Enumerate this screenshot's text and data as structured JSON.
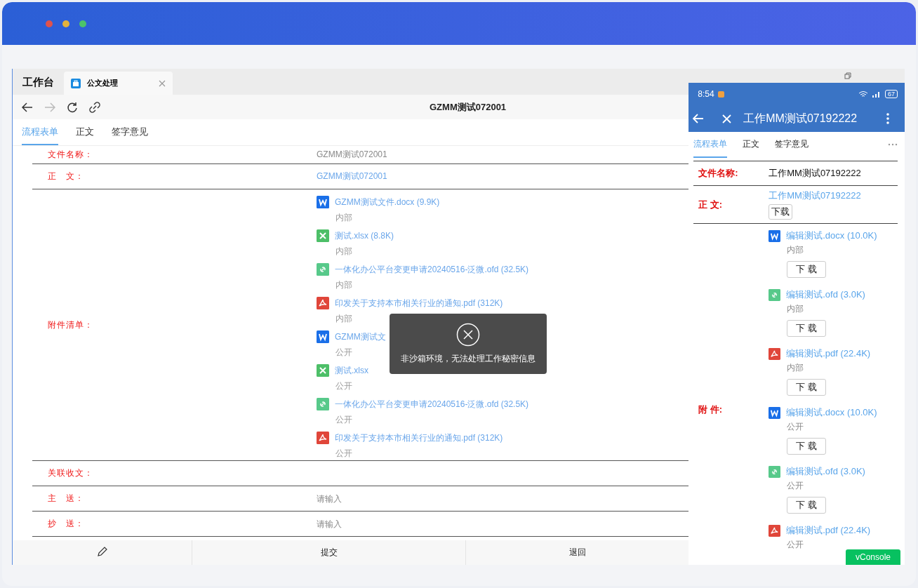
{
  "desktop": {
    "home_tab": "工作台",
    "tabs": [
      {
        "label": "公文处理",
        "selected": true
      }
    ],
    "page_title": "GZMM测试072001",
    "form_tabs": [
      {
        "label": "流程表单",
        "selected": true
      },
      {
        "label": "正文",
        "selected": false
      },
      {
        "label": "签字意见",
        "selected": false
      }
    ],
    "form": {
      "name_label": "文件名称：",
      "name_value": "GZMM测试072001",
      "body_label": "正　文：",
      "body_link": "GZMM测试072001",
      "attachments_label": "附件清单：",
      "attachments": [
        {
          "kind": "word",
          "name": "GZMM测试文件.docx (9.9K)",
          "access": "内部"
        },
        {
          "kind": "excel",
          "name": "测试.xlsx (8.8K)",
          "access": "内部"
        },
        {
          "kind": "ofd",
          "name": "一体化办公平台变更申请20240516-泛微.ofd (32.5K)",
          "access": "内部"
        },
        {
          "kind": "pdf",
          "name": "印发关于支持本市相关行业的通知.pdf (312K)",
          "access": "内部"
        },
        {
          "kind": "word",
          "name": "GZMM测试文",
          "access": "公开"
        },
        {
          "kind": "excel",
          "name": "测试.xlsx",
          "access": "公开"
        },
        {
          "kind": "ofd",
          "name": "一体化办公平台变更申请20240516-泛微.ofd (32.5K)",
          "access": "公开"
        },
        {
          "kind": "pdf",
          "name": "印发关于支持本市相关行业的通知.pdf (312K)",
          "access": "公开"
        }
      ],
      "related_label": "关联收文：",
      "to_label": "主　送：",
      "to_placeholder": "请输入",
      "cc_label": "抄　送：",
      "cc_placeholder": "请输入"
    },
    "toast": "非沙箱环境，无法处理工作秘密信息",
    "bottom_buttons": [
      {
        "kind": "icon"
      },
      {
        "kind": "text",
        "label": "提交"
      },
      {
        "kind": "text",
        "label": "退回"
      }
    ]
  },
  "phone": {
    "time": "8:54",
    "battery": "67",
    "title": "工作MM测试07192222",
    "form_tabs": [
      {
        "label": "流程表单",
        "selected": true
      },
      {
        "label": "正文",
        "selected": false
      },
      {
        "label": "签字意见",
        "selected": false
      }
    ],
    "name_label": "文件名称:",
    "name_value": "工作MM测试07192222",
    "body_label": "正  文:",
    "body_link": "工作MM测试07192222",
    "body_download": "下载",
    "attachments_label": "附  件:",
    "attachments": [
      {
        "kind": "word",
        "name": "编辑测试.docx (10.0K)",
        "access": "内部",
        "download": "下 载"
      },
      {
        "kind": "ofd",
        "name": "编辑测试.ofd (3.0K)",
        "access": "内部",
        "download": "下 载"
      },
      {
        "kind": "pdf",
        "name": "编辑测试.pdf (22.4K)",
        "access": "内部",
        "download": "下 载"
      },
      {
        "kind": "word",
        "name": "编辑测试.docx (10.0K)",
        "access": "公开",
        "download": "下 载"
      },
      {
        "kind": "ofd",
        "name": "编辑测试.ofd (3.0K)",
        "access": "公开",
        "download": "下 载"
      },
      {
        "kind": "pdf",
        "name": "编辑测试.pdf (22.4K)",
        "access": "公开"
      }
    ],
    "vconsole": "vConsole"
  }
}
